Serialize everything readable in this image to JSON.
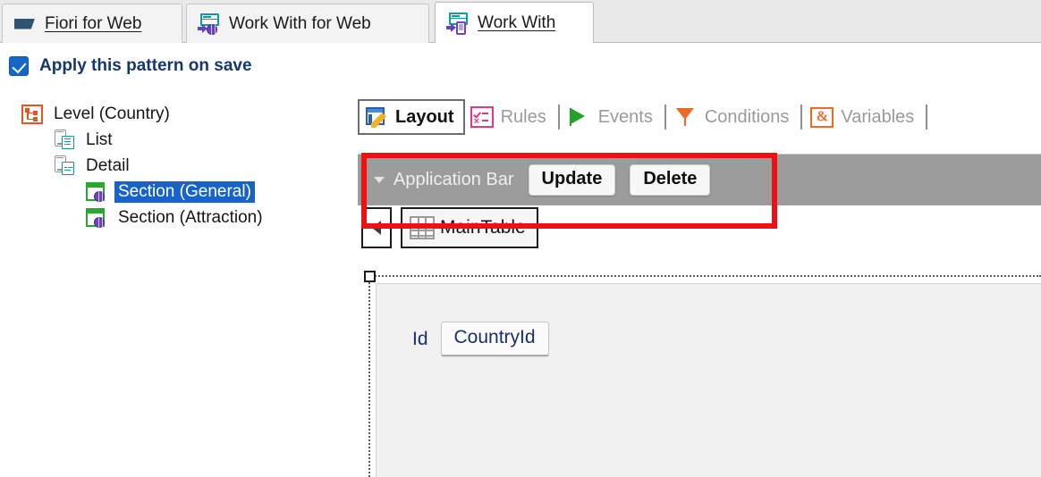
{
  "tabs": [
    {
      "label": "Fiori for Web",
      "icon": "fiori-flag-icon",
      "active": false,
      "underline": true
    },
    {
      "label": "Work With for Web",
      "icon": "web-work-with-icon",
      "active": false,
      "underline": false
    },
    {
      "label": "Work With",
      "icon": "mobile-work-with-icon",
      "active": true,
      "underline": true
    }
  ],
  "pattern_option": {
    "label": "Apply this pattern on save",
    "checked": true
  },
  "tree": [
    {
      "label": "Level (Country)",
      "icon": "level-node-icon",
      "indent": 0,
      "selected": false
    },
    {
      "label": "List",
      "icon": "device-list-icon",
      "indent": 1,
      "selected": false
    },
    {
      "label": "Detail",
      "icon": "device-detail-icon",
      "indent": 1,
      "selected": false
    },
    {
      "label": "Section (General)",
      "icon": "section-web-icon",
      "indent": 2,
      "selected": true
    },
    {
      "label": "Section (Attraction)",
      "icon": "section-web-icon",
      "indent": 2,
      "selected": false
    }
  ],
  "designer_tabs": [
    {
      "label": "Layout",
      "icon": "layout-pencil-icon",
      "active": true
    },
    {
      "label": "Rules",
      "icon": "rules-checklist-icon",
      "active": false
    },
    {
      "label": "Events",
      "icon": "events-flag-icon",
      "active": false
    },
    {
      "label": "Conditions",
      "icon": "conditions-funnel-icon",
      "active": false
    },
    {
      "label": "Variables",
      "icon": "variables-ampersand-icon",
      "active": false
    }
  ],
  "application_bar": {
    "title": "Application Bar",
    "buttons": [
      {
        "label": "Update"
      },
      {
        "label": "Delete"
      }
    ]
  },
  "content_tabs": {
    "scroll_left_label": "",
    "items": [
      {
        "label": "MainTable",
        "icon": "grid-table-icon",
        "active": true
      }
    ]
  },
  "form": {
    "fields": [
      {
        "label": "Id",
        "value": "CountryId"
      }
    ]
  },
  "colors": {
    "accent_blue": "#1763c7",
    "appbar_gray": "#9c9c9c",
    "highlight_red": "#ee1111",
    "tab_active_bg": "#ffffff",
    "label_blue": "#16316b",
    "level_orange": "#e8541f",
    "section_green": "#2aa631",
    "teal": "#0f9a9a",
    "purple": "#6d43bd"
  }
}
